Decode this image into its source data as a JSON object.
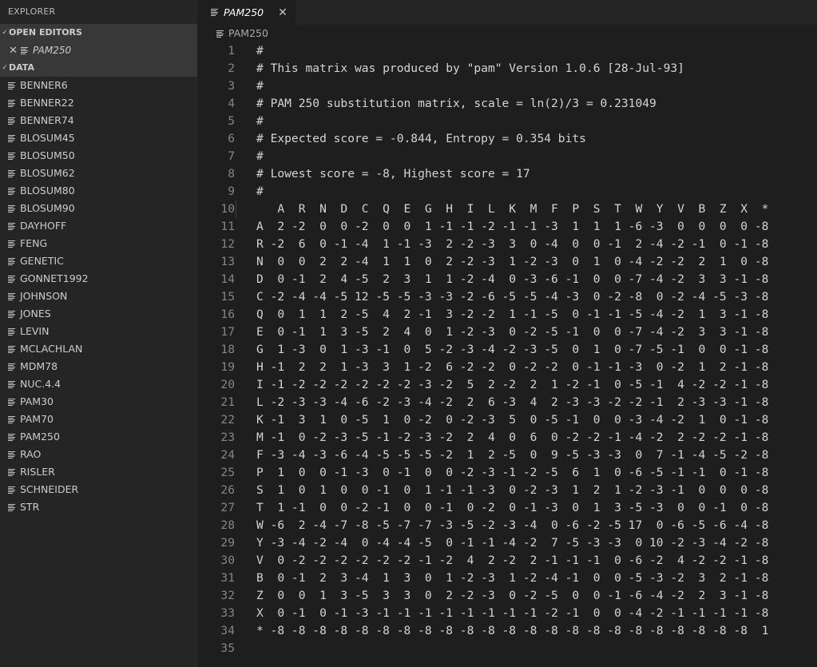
{
  "sidebar": {
    "title": "EXPLORER",
    "open_editors_label": "OPEN EDITORS",
    "open_editor_file": "PAM250",
    "data_label": "DATA",
    "files": [
      "BENNER6",
      "BENNER22",
      "BENNER74",
      "BLOSUM45",
      "BLOSUM50",
      "BLOSUM62",
      "BLOSUM80",
      "BLOSUM90",
      "DAYHOFF",
      "FENG",
      "GENETIC",
      "GONNET1992",
      "JOHNSON",
      "JONES",
      "LEVIN",
      "MCLACHLAN",
      "MDM78",
      "NUC.4.4",
      "PAM30",
      "PAM70",
      "PAM250",
      "RAO",
      "RISLER",
      "SCHNEIDER",
      "STR"
    ]
  },
  "tab": {
    "label": "PAM250"
  },
  "breadcrumb": {
    "label": "PAM250"
  },
  "editor": {
    "lines": [
      "#",
      "# This matrix was produced by \"pam\" Version 1.0.6 [28-Jul-93]",
      "#",
      "# PAM 250 substitution matrix, scale = ln(2)/3 = 0.231049",
      "#",
      "# Expected score = -0.844, Entropy = 0.354 bits",
      "#",
      "# Lowest score = -8, Highest score = 17",
      "#",
      "   A  R  N  D  C  Q  E  G  H  I  L  K  M  F  P  S  T  W  Y  V  B  Z  X  *",
      "A  2 -2  0  0 -2  0  0  1 -1 -1 -2 -1 -1 -3  1  1  1 -6 -3  0  0  0  0 -8",
      "R -2  6  0 -1 -4  1 -1 -3  2 -2 -3  3  0 -4  0  0 -1  2 -4 -2 -1  0 -1 -8",
      "N  0  0  2  2 -4  1  1  0  2 -2 -3  1 -2 -3  0  1  0 -4 -2 -2  2  1  0 -8",
      "D  0 -1  2  4 -5  2  3  1  1 -2 -4  0 -3 -6 -1  0  0 -7 -4 -2  3  3 -1 -8",
      "C -2 -4 -4 -5 12 -5 -5 -3 -3 -2 -6 -5 -5 -4 -3  0 -2 -8  0 -2 -4 -5 -3 -8",
      "Q  0  1  1  2 -5  4  2 -1  3 -2 -2  1 -1 -5  0 -1 -1 -5 -4 -2  1  3 -1 -8",
      "E  0 -1  1  3 -5  2  4  0  1 -2 -3  0 -2 -5 -1  0  0 -7 -4 -2  3  3 -1 -8",
      "G  1 -3  0  1 -3 -1  0  5 -2 -3 -4 -2 -3 -5  0  1  0 -7 -5 -1  0  0 -1 -8",
      "H -1  2  2  1 -3  3  1 -2  6 -2 -2  0 -2 -2  0 -1 -1 -3  0 -2  1  2 -1 -8",
      "I -1 -2 -2 -2 -2 -2 -2 -3 -2  5  2 -2  2  1 -2 -1  0 -5 -1  4 -2 -2 -1 -8",
      "L -2 -3 -3 -4 -6 -2 -3 -4 -2  2  6 -3  4  2 -3 -3 -2 -2 -1  2 -3 -3 -1 -8",
      "K -1  3  1  0 -5  1  0 -2  0 -2 -3  5  0 -5 -1  0  0 -3 -4 -2  1  0 -1 -8",
      "M -1  0 -2 -3 -5 -1 -2 -3 -2  2  4  0  6  0 -2 -2 -1 -4 -2  2 -2 -2 -1 -8",
      "F -3 -4 -3 -6 -4 -5 -5 -5 -2  1  2 -5  0  9 -5 -3 -3  0  7 -1 -4 -5 -2 -8",
      "P  1  0  0 -1 -3  0 -1  0  0 -2 -3 -1 -2 -5  6  1  0 -6 -5 -1 -1  0 -1 -8",
      "S  1  0  1  0  0 -1  0  1 -1 -1 -3  0 -2 -3  1  2  1 -2 -3 -1  0  0  0 -8",
      "T  1 -1  0  0 -2 -1  0  0 -1  0 -2  0 -1 -3  0  1  3 -5 -3  0  0 -1  0 -8",
      "W -6  2 -4 -7 -8 -5 -7 -7 -3 -5 -2 -3 -4  0 -6 -2 -5 17  0 -6 -5 -6 -4 -8",
      "Y -3 -4 -2 -4  0 -4 -4 -5  0 -1 -1 -4 -2  7 -5 -3 -3  0 10 -2 -3 -4 -2 -8",
      "V  0 -2 -2 -2 -2 -2 -2 -1 -2  4  2 -2  2 -1 -1 -1  0 -6 -2  4 -2 -2 -1 -8",
      "B  0 -1  2  3 -4  1  3  0  1 -2 -3  1 -2 -4 -1  0  0 -5 -3 -2  3  2 -1 -8",
      "Z  0  0  1  3 -5  3  3  0  2 -2 -3  0 -2 -5  0  0 -1 -6 -4 -2  2  3 -1 -8",
      "X  0 -1  0 -1 -3 -1 -1 -1 -1 -1 -1 -1 -1 -2 -1  0  0 -4 -2 -1 -1 -1 -1 -8",
      "* -8 -8 -8 -8 -8 -8 -8 -8 -8 -8 -8 -8 -8 -8 -8 -8 -8 -8 -8 -8 -8 -8 -8  1",
      ""
    ]
  }
}
